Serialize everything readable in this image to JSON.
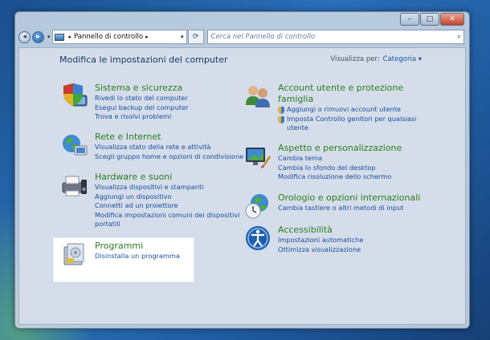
{
  "window": {
    "minimize_symbol": "–",
    "maximize_symbol": "□",
    "close_symbol": "✕"
  },
  "navbar": {
    "back_symbol": "◂",
    "forward_symbol": "▸",
    "dropdown_symbol": "▾",
    "address": "Pannello di controllo",
    "address_sep": "▸",
    "address_dropdown": "▾",
    "refresh_symbol": "⟳",
    "search_placeholder": "Cerca nel Pannello di controllo",
    "search_symbol": "⌕"
  },
  "header": {
    "title": "Modifica le impostazioni del computer",
    "view_label": "Visualizza per:",
    "view_value": "Categoria ▾"
  },
  "left_categories": [
    {
      "title": "Sistema e sicurezza",
      "icon": "shield-computer-icon",
      "links": [
        "Rivedi lo stato del computer",
        "Esegui backup del computer",
        "Trova e risolvi problemi"
      ]
    },
    {
      "title": "Rete e Internet",
      "icon": "network-globe-icon",
      "links": [
        "Visualizza stato della rete e attività",
        "Scegli gruppo home e opzioni di condivisione"
      ]
    },
    {
      "title": "Hardware e suoni",
      "icon": "printer-speaker-icon",
      "links": [
        "Visualizza dispositivi e stampanti",
        "Aggiungi un dispositivo",
        "Connetti ad un proiettore",
        "Modifica impostazioni comuni dei dispositivi",
        "portatili"
      ]
    },
    {
      "title": "Programmi",
      "icon": "programs-box-icon",
      "links": [
        "Disinstalla un programma"
      ]
    }
  ],
  "right_categories": [
    {
      "title_line1": "Account utente e protezione",
      "title_line2": "famiglia",
      "icon": "users-icon",
      "links": [
        "Aggiungi o rimuovi account utente",
        "Imposta Controllo genitori per qualsiasi",
        "utente"
      ]
    },
    {
      "title": "Aspetto e personalizzazione",
      "icon": "monitor-paintbrush-icon",
      "links": [
        "Cambia tema",
        "Cambia lo sfondo del desktop",
        "Modifica risoluzione dello schermo"
      ]
    },
    {
      "title": "Orologio e opzioni internazionali",
      "icon": "globe-clock-icon",
      "links": [
        "Cambia tastiere o altri metodi di input"
      ]
    },
    {
      "title": "Accessibilità",
      "icon": "accessibility-icon",
      "links": [
        "Impostazioni automatiche",
        "Ottimizza visualizzazione"
      ]
    }
  ]
}
